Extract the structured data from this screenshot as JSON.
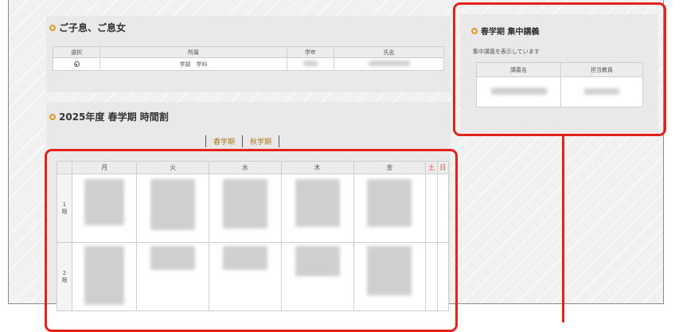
{
  "children": {
    "title": "ご子息、ご息女",
    "columns": [
      "選択",
      "所属",
      "学年",
      "氏名"
    ],
    "row": {
      "affiliation": "学部　学科"
    }
  },
  "timetable": {
    "title": "2025年度 春学期 時間割",
    "tabs": [
      "春学期",
      "秋学期"
    ],
    "days": [
      "月",
      "火",
      "水",
      "木",
      "金",
      "土",
      "日"
    ],
    "periods": [
      {
        "number": "1",
        "unit": "限"
      },
      {
        "number": "2",
        "unit": "限"
      }
    ]
  },
  "intensive": {
    "title": "春学期 集中講義",
    "message": "集中講義を表示しています",
    "columns": [
      "講義名",
      "担当教員"
    ]
  },
  "colors": {
    "accent_red": "#e5221a",
    "accent_orange": "#e39a1c",
    "tab_text": "#a87a16",
    "weekend": "#d94a4a"
  }
}
